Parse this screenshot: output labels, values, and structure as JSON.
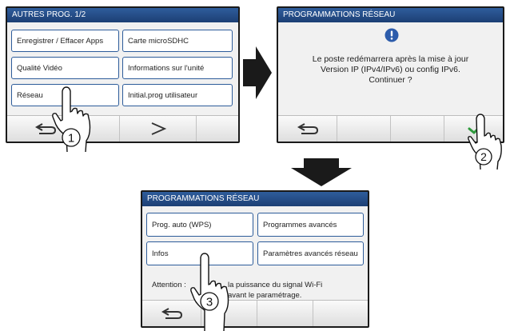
{
  "screen1": {
    "title": "AUTRES PROG. 1/2",
    "buttons": {
      "apps": "Enregistrer / Effacer Apps",
      "sd": "Carte microSDHC",
      "video": "Qualité Vidéo",
      "unit_info": "Informations sur l'unité",
      "network": "Réseau",
      "init": "Initial.prog utilisateur"
    },
    "back_icon": "back-arrow-icon",
    "next_icon": "next-chevron-icon",
    "step": "1"
  },
  "screen2": {
    "title": "PROGRAMMATIONS RÉSEAU",
    "alert_icon": "exclamation-icon",
    "message": "Le poste redémarrera après la mise à jour\nVersion IP (IPv4/IPv6) ou config IPv6.\nContinuer ?",
    "confirm_icon": "checkmark-icon",
    "step": "2"
  },
  "screen3": {
    "title": "PROGRAMMATIONS RÉSEAU",
    "buttons": {
      "wps": "Prog. auto (WPS)",
      "advanced": "Programmes avancés",
      "info": "Infos",
      "net_adv": "Paramètres avancés réseau"
    },
    "note_line1_left": "Attention :",
    "note_line1_right": "la puissance du signal Wi-Fi",
    "note_line2": "avant le paramétrage.",
    "step": "3"
  },
  "colors": {
    "accent": "#2d5c9a",
    "titlebar": "#1c3f74",
    "check": "#2e9a3c",
    "arrow": "#1a1a1a"
  }
}
